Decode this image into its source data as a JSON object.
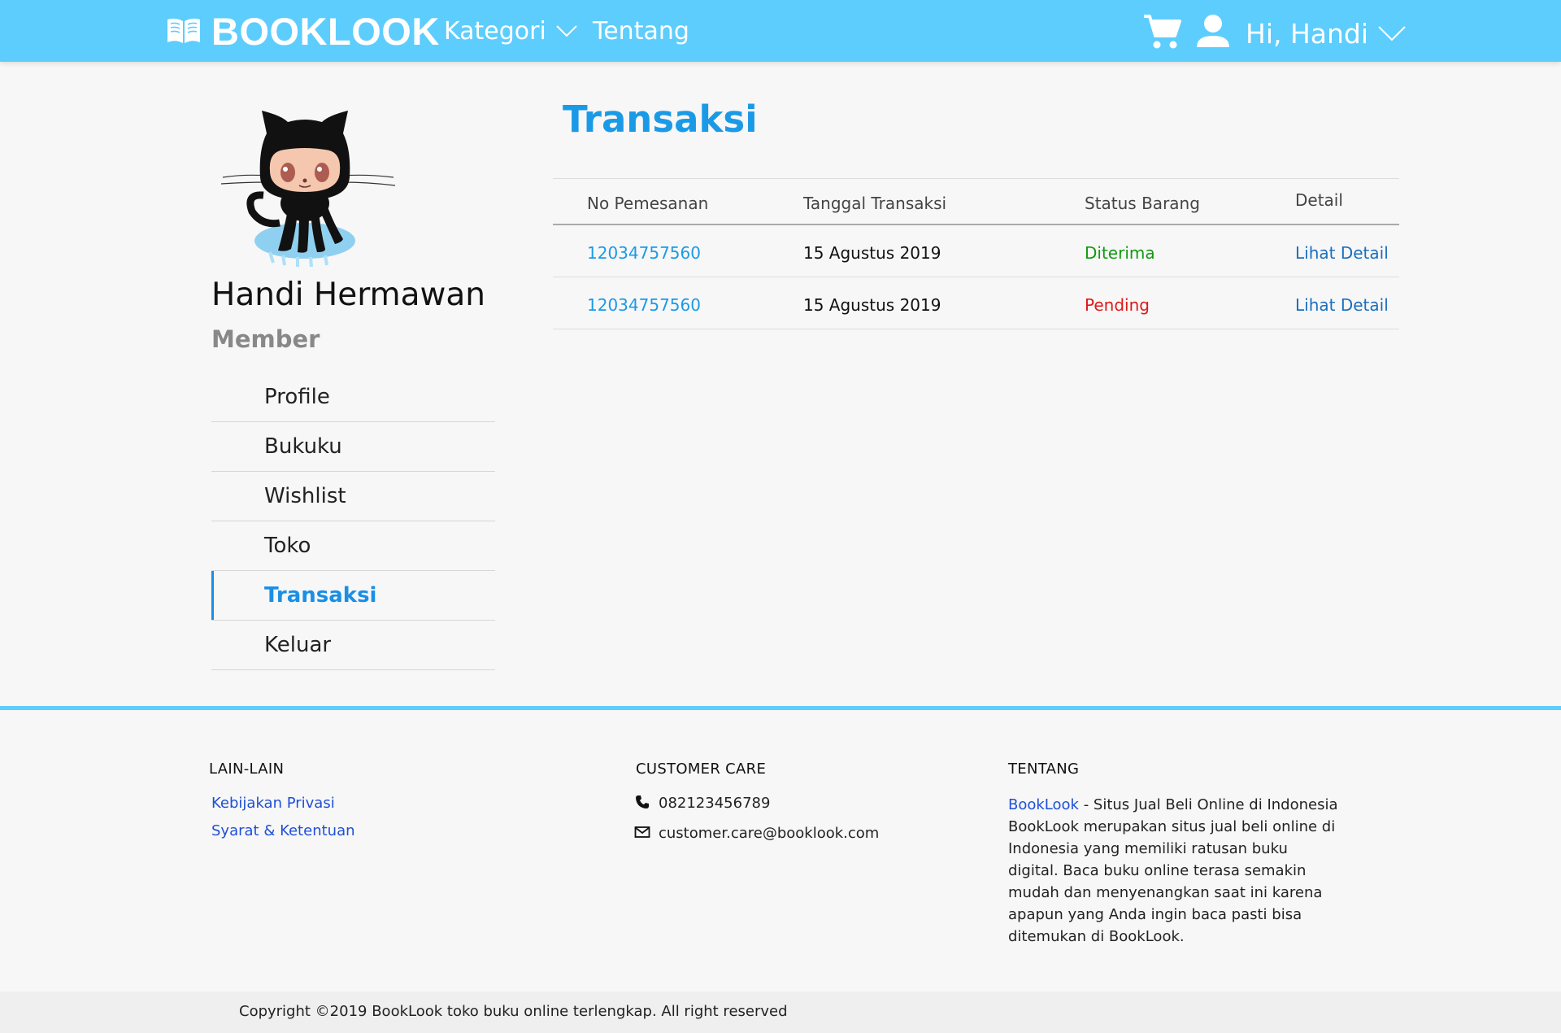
{
  "header": {
    "logo": "BOOKLOOK",
    "nav_kategori": "Kategori",
    "nav_tentang": "Tentang",
    "greeting": "Hi, Handi"
  },
  "profile": {
    "name": "Handi Hermawan",
    "role": "Member"
  },
  "menu": {
    "items": [
      {
        "label": "Profile"
      },
      {
        "label": "Bukuku"
      },
      {
        "label": "Wishlist"
      },
      {
        "label": "Toko"
      },
      {
        "label": "Transaksi",
        "active": true
      },
      {
        "label": "Keluar"
      }
    ]
  },
  "main": {
    "title": "Transaksi",
    "columns": [
      "No Pemesanan",
      "Tanggal Transaksi",
      "Status Barang",
      "Detail"
    ],
    "rows": [
      {
        "order_no": "12034757560",
        "date": "15 Agustus 2019",
        "status": "Diterima",
        "status_color": "#109a10",
        "detail": "Lihat Detail"
      },
      {
        "order_no": "12034757560",
        "date": "15 Agustus 2019",
        "status": "Pending",
        "status_color": "#e01818",
        "detail": "Lihat Detail"
      }
    ]
  },
  "footer": {
    "lain_heading": "LAIN-LAIN",
    "lain_links": [
      "Kebijakan Privasi",
      "Syarat & Ketentuan"
    ],
    "care_heading": "CUSTOMER CARE",
    "phone": "082123456789",
    "email": "customer.care@booklook.com",
    "tentang_heading": "TENTANG",
    "about_brand": "BookLook",
    "about_text": " - Situs Jual Beli Online di Indonesia BookLook merupakan situs jual beli online di Indonesia yang memiliki ratusan buku digital. Baca buku online terasa semakin mudah dan menyenangkan saat ini karena apapun yang Anda ingin baca pasti bisa ditemukan di BookLook.",
    "copyright": "Copyright ©2019 BookLook toko buku online terlengkap. All right reserved"
  },
  "colors": {
    "header": "#5dcdfd",
    "accent": "#1a9ae6",
    "received": "#109a10",
    "pending": "#e01818"
  },
  "icons": [
    "book-icon",
    "chevron-down-icon",
    "cart-icon",
    "user-icon",
    "octocat-avatar",
    "phone-icon",
    "mail-icon"
  ]
}
